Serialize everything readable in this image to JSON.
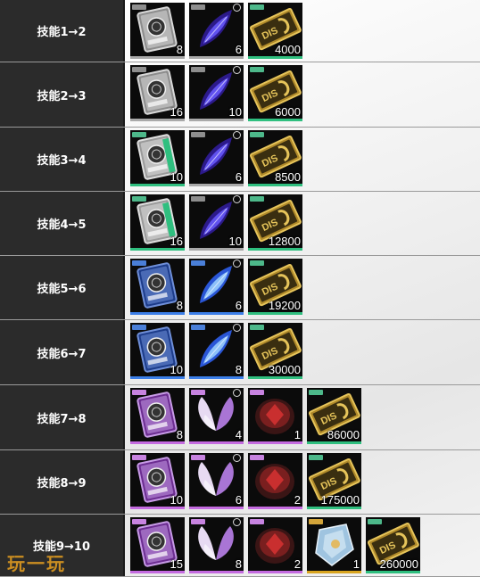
{
  "rows": [
    {
      "label": "技能1→2",
      "items": [
        {
          "type": "disk",
          "rarity": "white",
          "qty": "8"
        },
        {
          "type": "wing",
          "rarity": "white",
          "qty": "6"
        },
        {
          "type": "ticket",
          "rarity": "green",
          "qty": "4000"
        }
      ]
    },
    {
      "label": "技能2→3",
      "items": [
        {
          "type": "disk",
          "rarity": "white",
          "qty": "16"
        },
        {
          "type": "wing",
          "rarity": "white",
          "qty": "10"
        },
        {
          "type": "ticket",
          "rarity": "green",
          "qty": "6000"
        }
      ]
    },
    {
      "label": "技能3→4",
      "items": [
        {
          "type": "disk",
          "rarity": "green",
          "qty": "10"
        },
        {
          "type": "wing",
          "rarity": "white",
          "qty": "6"
        },
        {
          "type": "ticket",
          "rarity": "green",
          "qty": "8500"
        }
      ]
    },
    {
      "label": "技能4→5",
      "items": [
        {
          "type": "disk",
          "rarity": "green",
          "qty": "16"
        },
        {
          "type": "wing",
          "rarity": "white",
          "qty": "10"
        },
        {
          "type": "ticket",
          "rarity": "green",
          "qty": "12800"
        }
      ]
    },
    {
      "label": "技能5→6",
      "items": [
        {
          "type": "disk",
          "rarity": "blue",
          "qty": "8"
        },
        {
          "type": "wing",
          "rarity": "blue",
          "qty": "6"
        },
        {
          "type": "ticket",
          "rarity": "green",
          "qty": "19200"
        }
      ]
    },
    {
      "label": "技能6→7",
      "items": [
        {
          "type": "disk",
          "rarity": "blue",
          "qty": "10"
        },
        {
          "type": "wing",
          "rarity": "blue",
          "qty": "8"
        },
        {
          "type": "ticket",
          "rarity": "green",
          "qty": "30000"
        }
      ]
    },
    {
      "label": "技能7→8",
      "items": [
        {
          "type": "disk",
          "rarity": "purple",
          "qty": "8"
        },
        {
          "type": "wing",
          "rarity": "purple",
          "qty": "4"
        },
        {
          "type": "stone",
          "rarity": "purple",
          "qty": "1"
        },
        {
          "type": "ticket",
          "rarity": "green",
          "qty": "86000"
        }
      ]
    },
    {
      "label": "技能8→9",
      "items": [
        {
          "type": "disk",
          "rarity": "purple",
          "qty": "10"
        },
        {
          "type": "wing",
          "rarity": "purple",
          "qty": "6"
        },
        {
          "type": "stone",
          "rarity": "purple",
          "qty": "2"
        },
        {
          "type": "ticket",
          "rarity": "green",
          "qty": "175000"
        }
      ]
    },
    {
      "label": "技能9→10",
      "items": [
        {
          "type": "disk",
          "rarity": "purple",
          "qty": "15"
        },
        {
          "type": "wing",
          "rarity": "purple",
          "qty": "8"
        },
        {
          "type": "stone",
          "rarity": "purple",
          "qty": "2"
        },
        {
          "type": "crystal",
          "rarity": "gold",
          "qty": "1"
        },
        {
          "type": "ticket",
          "rarity": "green",
          "qty": "260000"
        }
      ]
    }
  ],
  "watermark": "玩一玩",
  "colors": {
    "white": "#a9a9a9",
    "green": "#2fbf7f",
    "blue": "#3b7ee8",
    "purple": "#c46be0",
    "gold": "#d9a520"
  }
}
